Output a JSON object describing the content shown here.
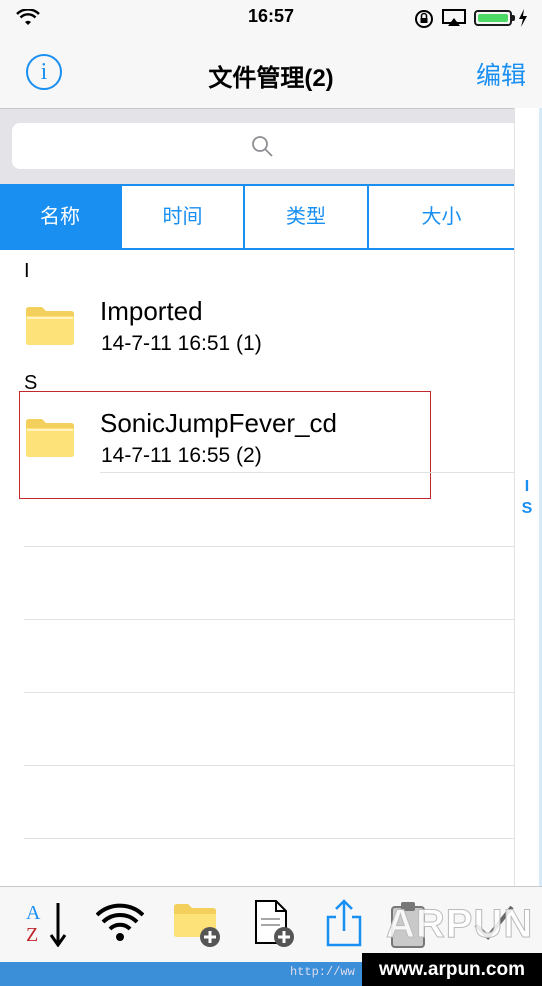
{
  "status_bar": {
    "time": "16:57"
  },
  "navbar": {
    "info_label": "i",
    "title": "文件管理(2)",
    "edit_label": "编辑"
  },
  "segments": [
    {
      "label": "名称",
      "active": true
    },
    {
      "label": "时间",
      "active": false
    },
    {
      "label": "类型",
      "active": false
    },
    {
      "label": "大小",
      "active": false
    }
  ],
  "sections": [
    {
      "header": "I",
      "items": [
        {
          "name": "Imported",
          "meta": "14-7-11 16:51 (1)"
        }
      ]
    },
    {
      "header": "S",
      "items": [
        {
          "name": "SonicJumpFever_cd",
          "meta": "14-7-11 16:55 (2)"
        }
      ]
    }
  ],
  "index_letters": [
    "I",
    "S"
  ],
  "toolbar": {
    "icons": [
      "sort-az-icon",
      "wifi-transfer-icon",
      "new-folder-icon",
      "new-file-icon",
      "share-icon",
      "clipboard-icon",
      "select-icon"
    ],
    "sort_label_a": "A",
    "sort_label_z": "Z"
  },
  "footer": {
    "url_text": "http://ww",
    "watermark": "ARPUN",
    "watermark_site": "www.arpun.com"
  },
  "colors": {
    "accent": "#1a8ff2",
    "highlight": "#c0272d",
    "battery": "#4cd964",
    "folder": "#fde27a"
  }
}
